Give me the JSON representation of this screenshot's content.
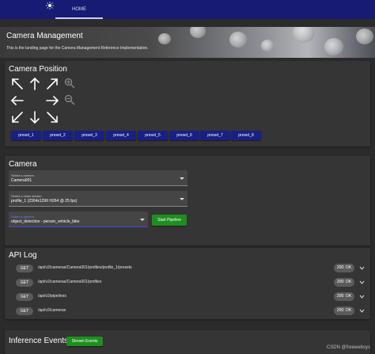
{
  "nav": {
    "home_label": "HOME",
    "icon": "sun-icon"
  },
  "hero": {
    "title": "Camera Management",
    "subtitle": "This is the landing page for the Camera Management Reference Implementation."
  },
  "camera_position": {
    "title": "Camera Position",
    "icons": [
      "arrow-up-left-icon",
      "arrow-up-icon",
      "arrow-up-right-icon",
      "zoom-in-icon",
      "arrow-left-icon",
      "arrow-right-icon",
      "zoom-out-icon",
      "arrow-down-left-icon",
      "arrow-down-icon",
      "arrow-down-right-icon"
    ],
    "presets": [
      "preset_1",
      "preset_2",
      "preset_3",
      "preset_4",
      "preset_5",
      "preset_6",
      "preset_7",
      "preset_8"
    ]
  },
  "camera": {
    "title": "Camera",
    "camera_select": {
      "label": "Select a camera",
      "value": "Camera001"
    },
    "stream_select": {
      "label": "Select a video stream",
      "value": "profile_1 (2304x1296 H264 @ 25 fps)"
    },
    "pipeline_select": {
      "label": "Select a pipeline",
      "value": "object_detection - person_vehicle_bike"
    },
    "start_pipeline_label": "Start Pipeline"
  },
  "api_log": {
    "title": "API Log",
    "rows": [
      {
        "method": "GET",
        "path": "/api/v2/cameras/Camera001/profiles/profile_1/presets",
        "status": "200: OK"
      },
      {
        "method": "GET",
        "path": "/api/v2/cameras/Camera001/profiles",
        "status": "200: OK"
      },
      {
        "method": "GET",
        "path": "/api/v2/pipelines",
        "status": "200: OK"
      },
      {
        "method": "GET",
        "path": "/api/v2/cameras",
        "status": "200: OK"
      }
    ]
  },
  "inference": {
    "title": "Inference Events",
    "stream_events_label": "Stream Events"
  },
  "watermark": "CSDN @freewebsys",
  "colors": {
    "topbar": "#171b73",
    "preset_button": "#1a1f86",
    "green_button": "#1e8f1e",
    "card": "#353535",
    "background": "#2b2b2b"
  }
}
